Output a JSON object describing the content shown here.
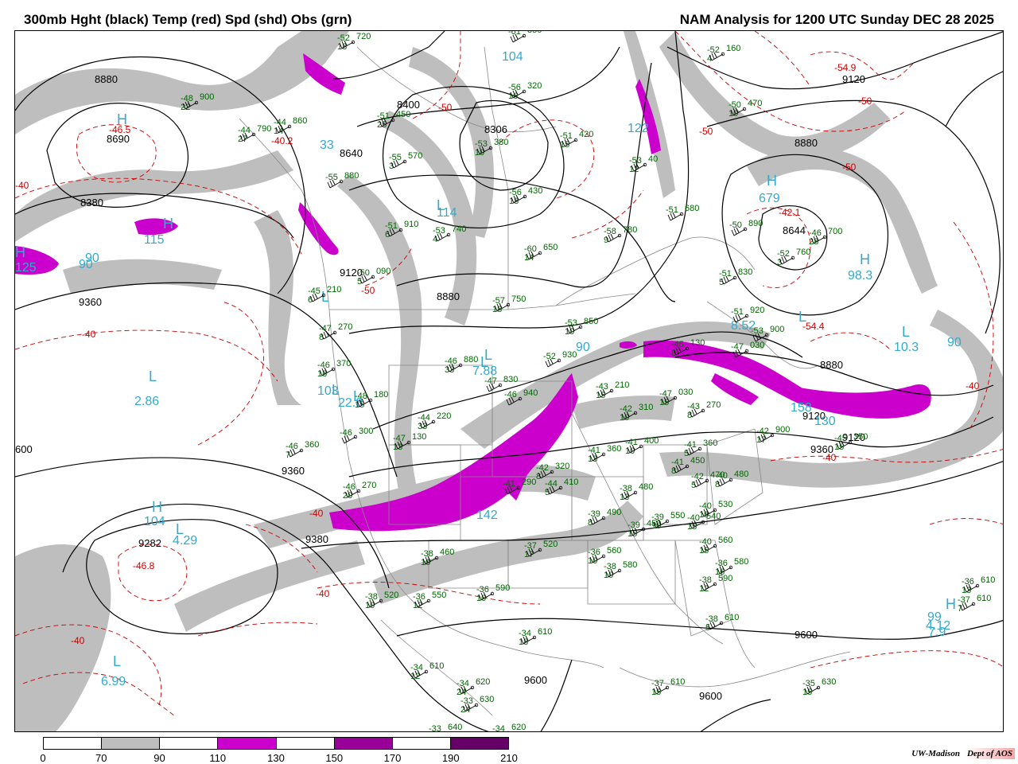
{
  "header": {
    "title_left": "300mb Hght (black) Temp (red) Spd (shd) Obs (grn)",
    "title_right": "NAM Analysis for 1200 UTC Sunday  DEC 28 2025"
  },
  "legend": {
    "ticks": [
      "0",
      "70",
      "90",
      "110",
      "130",
      "150",
      "170",
      "190",
      "210"
    ],
    "colors": [
      "#ffffff",
      "#bebebe",
      "#ffffff",
      "#cc00cc",
      "#ffffff",
      "#990099",
      "#ffffff",
      "#660066"
    ]
  },
  "credit": {
    "org": "UW-Madison",
    "dept": "Dept of AOS"
  },
  "map": {
    "colors": {
      "height": "#000000",
      "temp": "#cc0000",
      "obs": "#006600",
      "speed_label": "#33aacc",
      "shade70": "#bebebe",
      "shade110": "#cc00cc",
      "border": "#888888"
    },
    "height_labels": [
      {
        "text": "8880"
      },
      {
        "text": "8690"
      },
      {
        "text": "8380"
      },
      {
        "text": "9360"
      },
      {
        "text": "8400"
      },
      {
        "text": "8306"
      },
      {
        "text": "8640"
      },
      {
        "text": "9120"
      },
      {
        "text": "8880"
      },
      {
        "text": "9120"
      },
      {
        "text": "9120"
      },
      {
        "text": "8644"
      },
      {
        "text": "8880"
      },
      {
        "text": "9120"
      },
      {
        "text": "9360"
      },
      {
        "text": "9360"
      },
      {
        "text": "9380"
      },
      {
        "text": "9282"
      },
      {
        "text": "9600"
      },
      {
        "text": "9600"
      },
      {
        "text": "9600"
      },
      {
        "text": "600"
      },
      {
        "text": "8880"
      }
    ],
    "temp_labels": [
      {
        "text": "-46.5"
      },
      {
        "text": "-40.2"
      },
      {
        "text": "-50"
      },
      {
        "text": "-50"
      },
      {
        "text": "-54.9"
      },
      {
        "text": "-50"
      },
      {
        "text": "-50"
      },
      {
        "text": "-42.1"
      },
      {
        "text": "-54.4"
      },
      {
        "text": "-40"
      },
      {
        "text": "-40"
      },
      {
        "text": "-40"
      },
      {
        "text": "-46.8"
      },
      {
        "text": "-40"
      },
      {
        "text": "-40"
      },
      {
        "text": "-40"
      },
      {
        "text": "-50"
      },
      {
        "text": "-40"
      }
    ],
    "speed_labels": [
      {
        "text": "125"
      },
      {
        "text": "90"
      },
      {
        "text": "115"
      },
      {
        "text": "2.86"
      },
      {
        "text": "104"
      },
      {
        "text": "4.29"
      },
      {
        "text": "6.99"
      },
      {
        "text": "22.8"
      },
      {
        "text": "103"
      },
      {
        "text": "7.88"
      },
      {
        "text": "142"
      },
      {
        "text": "90"
      },
      {
        "text": "158"
      },
      {
        "text": "130"
      },
      {
        "text": "98.3"
      },
      {
        "text": "10.3"
      },
      {
        "text": "90"
      },
      {
        "text": "8.52"
      },
      {
        "text": "679"
      },
      {
        "text": "122"
      },
      {
        "text": "114"
      },
      {
        "text": "104"
      },
      {
        "text": "90"
      },
      {
        "text": "99"
      },
      {
        "text": "33"
      },
      {
        "text": "4.12"
      },
      {
        "text": "7.9"
      }
    ],
    "hl_marks": [
      {
        "text": "H"
      },
      {
        "text": "L"
      },
      {
        "text": "L"
      },
      {
        "text": "H"
      },
      {
        "text": "L"
      },
      {
        "text": "L"
      },
      {
        "text": "H"
      },
      {
        "text": "L"
      },
      {
        "text": "H"
      },
      {
        "text": "L"
      },
      {
        "text": "H"
      },
      {
        "text": "H"
      },
      {
        "text": "L"
      },
      {
        "text": "L"
      },
      {
        "text": "L"
      },
      {
        "text": "H"
      },
      {
        "text": "L"
      },
      {
        "text": "L"
      }
    ],
    "obs": [
      {
        "t": "-52",
        "h": "720",
        "d": "18"
      },
      {
        "t": "-48",
        "h": "900",
        "d": "22"
      },
      {
        "t": "-44",
        "h": "790",
        "d": "27"
      },
      {
        "t": "-44",
        "h": "860",
        "d": "14"
      },
      {
        "t": "-51",
        "h": "450",
        "d": "25"
      },
      {
        "t": "-55",
        "h": "570",
        "d": "3"
      },
      {
        "t": "-53",
        "h": "380",
        "d": "10"
      },
      {
        "t": "-56",
        "h": "320",
        "d": "16"
      },
      {
        "t": "-51",
        "h": "420",
        "d": "15"
      },
      {
        "t": "-56",
        "h": "430",
        "d": "18"
      },
      {
        "t": "-52",
        "h": "160",
        "d": "4"
      },
      {
        "t": "-50",
        "h": "470",
        "d": "10"
      },
      {
        "t": "-53",
        "h": "40",
        "d": "12"
      },
      {
        "t": "-51",
        "h": "680",
        "d": ""
      },
      {
        "t": "-50",
        "h": "890",
        "d": ""
      },
      {
        "t": "-46",
        "h": "700",
        "d": "28"
      },
      {
        "t": "-52",
        "h": "760",
        "d": "3"
      },
      {
        "t": "-51",
        "h": "830",
        "d": "5"
      },
      {
        "t": "-55",
        "h": "880",
        "d": ""
      },
      {
        "t": "-51",
        "h": "910",
        "d": "6"
      },
      {
        "t": "-53",
        "h": "740",
        "d": "4"
      },
      {
        "t": "-58",
        "h": "780",
        "d": "9"
      },
      {
        "t": "-60",
        "h": "650",
        "d": "14"
      },
      {
        "t": "-50",
        "h": "090",
        "d": "5"
      },
      {
        "t": "-45",
        "h": "210",
        "d": "6"
      },
      {
        "t": "-47",
        "h": "270",
        "d": "8"
      },
      {
        "t": "-46",
        "h": "370",
        "d": "18"
      },
      {
        "t": "-46",
        "h": "880",
        "d": "33"
      },
      {
        "t": "-47",
        "h": "830",
        "d": ""
      },
      {
        "t": "-52",
        "h": "930",
        "d": ""
      },
      {
        "t": "-53",
        "h": "850",
        "d": "10"
      },
      {
        "t": "-57",
        "h": "750",
        "d": "18"
      },
      {
        "t": "-46",
        "h": "940",
        "d": ""
      },
      {
        "t": "-48",
        "h": "180",
        "d": "15"
      },
      {
        "t": "-44",
        "h": "220",
        "d": "33"
      },
      {
        "t": "-47",
        "h": "130",
        "d": "13"
      },
      {
        "t": "-46",
        "h": "300",
        "d": ""
      },
      {
        "t": "-46",
        "h": "360",
        "d": "7"
      },
      {
        "t": "-46",
        "h": "270",
        "d": "20"
      },
      {
        "t": "-41",
        "h": "290",
        "d": ""
      },
      {
        "t": "-42",
        "h": "320",
        "d": "8"
      },
      {
        "t": "-43",
        "h": "210",
        "d": "15"
      },
      {
        "t": "-42",
        "h": "310",
        "d": "10"
      },
      {
        "t": "-45",
        "h": "130",
        "d": "8"
      },
      {
        "t": "-47",
        "h": "030",
        "d": "15"
      },
      {
        "t": "-43",
        "h": "270",
        "d": "8"
      },
      {
        "t": "-42",
        "h": "900",
        "d": "17"
      },
      {
        "t": "-41",
        "h": "360",
        "d": "13"
      },
      {
        "t": "-41",
        "h": "400",
        "d": "10"
      },
      {
        "t": "-41",
        "h": "450",
        "d": "8"
      },
      {
        "t": "-41",
        "h": "360",
        "d": "5"
      },
      {
        "t": "-40",
        "h": "480",
        "d": "8"
      },
      {
        "t": "-42",
        "h": "470",
        "d": "5"
      },
      {
        "t": "-38",
        "h": "480",
        "d": "13"
      },
      {
        "t": "-39",
        "h": "450",
        "d": "15"
      },
      {
        "t": "-39",
        "h": "490",
        "d": "8"
      },
      {
        "t": "-39",
        "h": "550",
        "d": "10"
      },
      {
        "t": "-40",
        "h": "540",
        "d": "15"
      },
      {
        "t": "-40",
        "h": "530",
        "d": "10"
      },
      {
        "t": "-40",
        "h": "560",
        "d": "15"
      },
      {
        "t": "-36",
        "h": "560",
        "d": "10"
      },
      {
        "t": "-38",
        "h": "580",
        "d": "10"
      },
      {
        "t": "-36",
        "h": "580",
        "d": "16"
      },
      {
        "t": "-38",
        "h": "590",
        "d": "12"
      },
      {
        "t": "-38",
        "h": "610",
        "d": "5"
      },
      {
        "t": "-37",
        "h": "520",
        "d": "17"
      },
      {
        "t": "-38",
        "h": "460",
        "d": "10"
      },
      {
        "t": "-38",
        "h": "520",
        "d": "10"
      },
      {
        "t": "-36",
        "h": "550",
        "d": "12"
      },
      {
        "t": "-36",
        "h": "590",
        "d": "10"
      },
      {
        "t": "-34",
        "h": "610",
        "d": "18"
      },
      {
        "t": "-34",
        "h": "610",
        "d": "12"
      },
      {
        "t": "-34",
        "h": "620",
        "d": "24"
      },
      {
        "t": "-33",
        "h": "630",
        "d": "24"
      },
      {
        "t": "-33",
        "h": "640",
        "d": ""
      },
      {
        "t": "-34",
        "h": "620",
        "d": ""
      },
      {
        "t": "-37",
        "h": "610",
        "d": "15"
      },
      {
        "t": "-35",
        "h": "630",
        "d": "15"
      },
      {
        "t": "-36",
        "h": "610",
        "d": "13"
      },
      {
        "t": "-37",
        "h": "610",
        "d": "7"
      },
      {
        "t": "-44",
        "h": "410",
        "d": "5"
      },
      {
        "t": "-51",
        "h": "920",
        "d": ""
      },
      {
        "t": "-53",
        "h": "900",
        "d": ""
      },
      {
        "t": "-47",
        "h": "030",
        "d": ""
      },
      {
        "t": "-45",
        "h": "350",
        "d": "15"
      },
      {
        "t": "-61",
        "h": "350",
        "d": ""
      }
    ]
  }
}
